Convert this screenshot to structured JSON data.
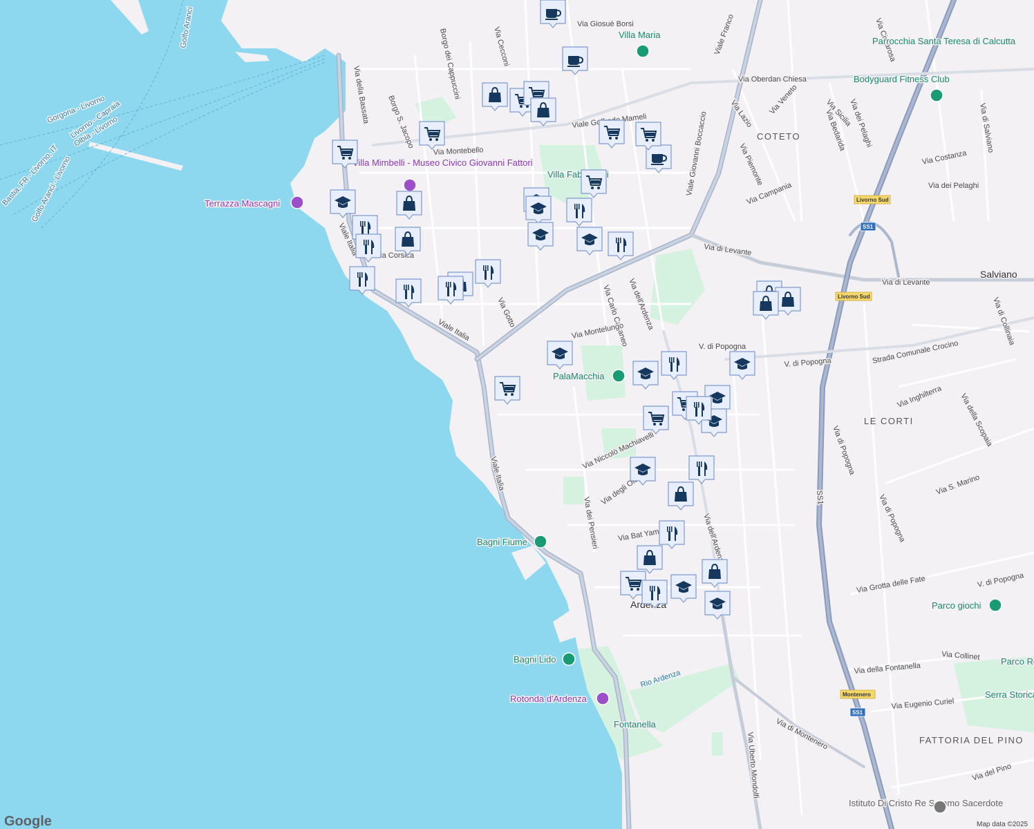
{
  "map": {
    "attribution": "Map data ©2025",
    "logo": "Google",
    "colors": {
      "sea": "#8dd8ef",
      "land": "#f3f1f4",
      "park": "#d5f1df",
      "road_major": "#a8b4c8",
      "marker_fill": "#e8eefb",
      "marker_icon": "#17385e"
    }
  },
  "labels": {
    "streets": [
      "Via Giosuè Borsi",
      "Villa Maria",
      "Viale Goffredo Mameli",
      "Via Montebello",
      "Via Oberdan Chiesa",
      "Borgo dei Cappuccini",
      "Via Cecconi",
      "Via della Bassata",
      "Borgo S. Jacopo",
      "Viale Giovanni Boccaccio",
      "Via Lazio",
      "Via Veneto",
      "Via Sicilia",
      "Via Bedarida",
      "Via dei Pelaghi",
      "Via Piemonte",
      "Via Campania",
      "Via Costanza",
      "Via dei Pelaghi",
      "Via di Salviano",
      "Via Cimarosa",
      "Via di Levante",
      "Via di Levante",
      "Viale Italia",
      "Via Corsica",
      "Via Gotto",
      "Via Carlo Cattaneo",
      "Via dell'Ardenza",
      "V. di Popogna",
      "V. di Popogna",
      "Strada Comunale Crocino",
      "Via di Collinaia",
      "Via Inghilterra",
      "Via della Scopaia",
      "Via S. Marino",
      "Via di Popogna",
      "Via di Popogna",
      "SS1",
      "Via Niccolò Machiavelli",
      "Via degli Oleandri",
      "Via dei Pensieri",
      "Via Bat Yam",
      "Via dell'Ardenza",
      "Via Grotta delle Fate",
      "V. di Popogna",
      "Viale Italia",
      "Viale Italia",
      "Rio Ardenza",
      "Via Uberto Mondolfi",
      "Via di Montenero",
      "Via della Fontanella",
      "Via Eugenio Curiel",
      "Via Collinet",
      "Via del Pino",
      "Via Montelungo",
      "Villa Fabbricotti",
      "Viale Franco"
    ],
    "districts": [
      "COTETO",
      "LE CORTI",
      "FATTORIA DEL PINO",
      "Salviano",
      "Ardenza"
    ],
    "pois": [
      {
        "name": "Parrocchia Santa Teresa di Calcutta",
        "kind": "church"
      },
      {
        "name": "Bodyguard Fitness Club",
        "kind": "gym"
      },
      {
        "name": "PalaMacchia",
        "kind": "sports"
      },
      {
        "name": "Bagni Fiume",
        "kind": "beach"
      },
      {
        "name": "Bagni Lido",
        "kind": "beach"
      },
      {
        "name": "Parco giochi",
        "kind": "park"
      },
      {
        "name": "Parco Rodocanacchi",
        "kind": "park"
      },
      {
        "name": "Serra Storica Villa Mauro",
        "kind": "park"
      },
      {
        "name": "Istituto Di Cristo Re Sommo Sacerdote",
        "kind": "church"
      },
      {
        "name": "Terrazza Mascagni",
        "kind": "viewpoint"
      },
      {
        "name": "Rotonda d'Ardenza",
        "kind": "viewpoint"
      },
      {
        "name": "Villa Mimbelli - Museo Civico Giovanni Fattori",
        "kind": "museum"
      },
      {
        "name": "Fontanella",
        "kind": "small"
      }
    ],
    "ferries": [
      "Gorgona - Livorno",
      "Livorno - Capraia",
      "Olbia - Livorno",
      "Bastia, FR - Livorno, IT",
      "Golfo Aranci - Livorno",
      "Golfo Aranci"
    ],
    "shields": [
      "Livorno Sud",
      "Livorno Sud",
      "SS1",
      "Montenero",
      "SS1"
    ]
  },
  "markers": [
    {
      "icon": "coffee-icon"
    },
    {
      "icon": "coffee-icon"
    },
    {
      "icon": "coffee-icon"
    },
    {
      "icon": "cart-icon"
    },
    {
      "icon": "cart-icon"
    },
    {
      "icon": "cart-icon"
    },
    {
      "icon": "cart-icon"
    },
    {
      "icon": "cart-icon"
    },
    {
      "icon": "cart-icon"
    },
    {
      "icon": "cart-icon"
    },
    {
      "icon": "cart-icon"
    },
    {
      "icon": "cart-icon"
    },
    {
      "icon": "cart-icon"
    },
    {
      "icon": "cart-icon"
    },
    {
      "icon": "bag-icon"
    },
    {
      "icon": "bag-icon"
    },
    {
      "icon": "bag-icon"
    },
    {
      "icon": "bag-icon"
    },
    {
      "icon": "bag-icon"
    },
    {
      "icon": "bag-icon"
    },
    {
      "icon": "bag-icon"
    },
    {
      "icon": "bag-icon"
    },
    {
      "icon": "bag-icon"
    },
    {
      "icon": "bag-icon"
    },
    {
      "icon": "bag-icon"
    },
    {
      "icon": "school-icon"
    },
    {
      "icon": "school-icon"
    },
    {
      "icon": "school-icon"
    },
    {
      "icon": "school-icon"
    },
    {
      "icon": "school-icon"
    },
    {
      "icon": "school-icon"
    },
    {
      "icon": "school-icon"
    },
    {
      "icon": "school-icon"
    },
    {
      "icon": "school-icon"
    },
    {
      "icon": "school-icon"
    },
    {
      "icon": "school-icon"
    },
    {
      "icon": "school-icon"
    },
    {
      "icon": "school-icon"
    },
    {
      "icon": "restaurant-icon"
    },
    {
      "icon": "restaurant-icon"
    },
    {
      "icon": "restaurant-icon"
    },
    {
      "icon": "restaurant-icon"
    },
    {
      "icon": "restaurant-icon"
    },
    {
      "icon": "restaurant-icon"
    },
    {
      "icon": "restaurant-icon"
    },
    {
      "icon": "restaurant-icon"
    },
    {
      "icon": "restaurant-icon"
    },
    {
      "icon": "restaurant-icon"
    },
    {
      "icon": "restaurant-icon"
    },
    {
      "icon": "restaurant-icon"
    },
    {
      "icon": "restaurant-icon"
    }
  ]
}
